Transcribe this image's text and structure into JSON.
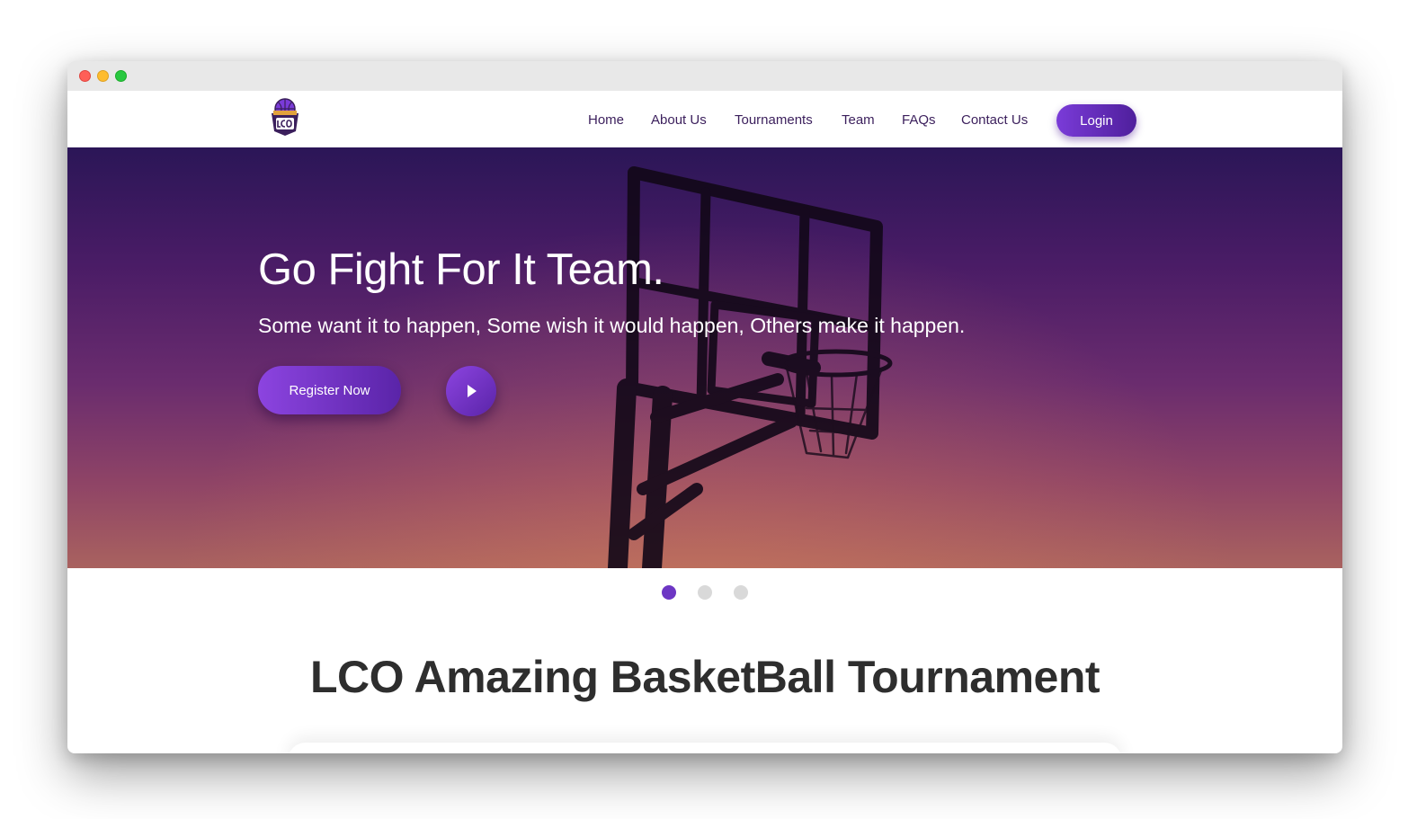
{
  "nav": {
    "logo_icon": "lco-basketball-logo-icon",
    "items": [
      {
        "label": "Home"
      },
      {
        "label": "About Us"
      },
      {
        "label": "Tournaments"
      },
      {
        "label": "Team"
      },
      {
        "label": "FAQs"
      },
      {
        "label": "Contact Us"
      }
    ],
    "login_label": "Login"
  },
  "hero": {
    "title": "Go Fight For It Team.",
    "subtitle": "Some want it to happen, Some wish it would happen, Others make it happen.",
    "register_label": "Register Now",
    "play_icon": "play-icon",
    "background_image": "basketball-hoop-silhouette-sunset"
  },
  "carousel": {
    "slide_count": 3,
    "active_index": 0
  },
  "section": {
    "title": "LCO Amazing BasketBall Tournament"
  },
  "colors": {
    "accent": "#6d36c4",
    "accent_dark": "#4f1f9c",
    "nav_text": "#3b1f5c",
    "hero_top": "#2b1657",
    "hero_bottom": "#a9625f",
    "heading_text": "#2e2e2e"
  }
}
